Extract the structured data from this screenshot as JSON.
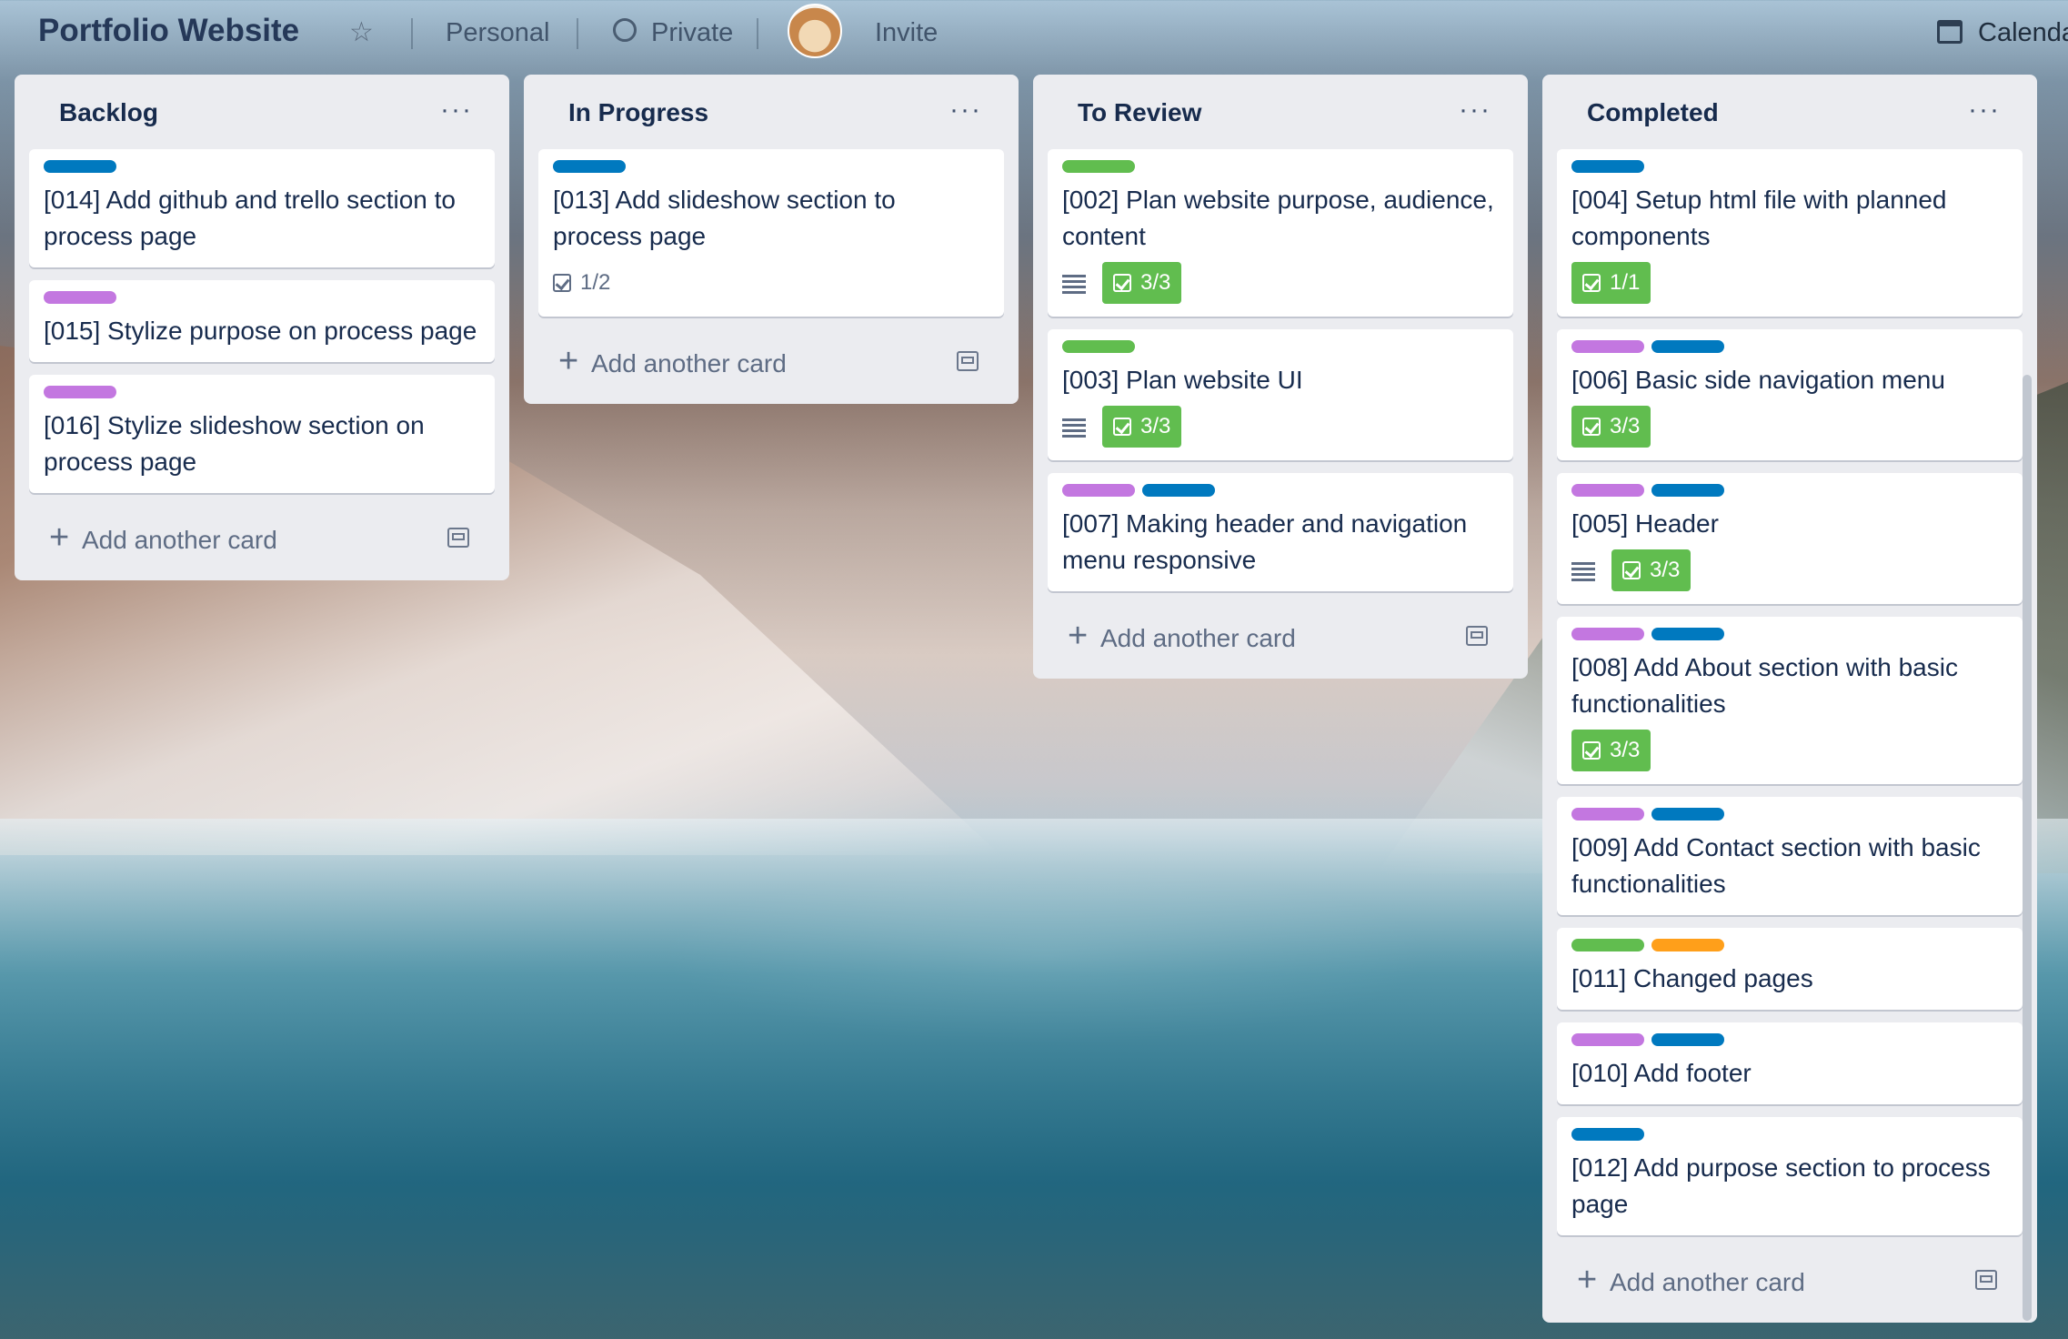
{
  "topbar": {
    "title": "Portfolio Website",
    "workspace": "Personal",
    "visibility": "Private",
    "invite": "Invite",
    "calendar": "Calenda"
  },
  "label_colors": {
    "blue": "#0079bf",
    "purple": "#c377e0",
    "green": "#61bd4f",
    "orange": "#ff9f1a"
  },
  "add_card_label": "Add another card",
  "lists": [
    {
      "title": "Backlog",
      "menu": "···",
      "cards": [
        {
          "title": "[014] Add github and trello section to process page",
          "labels": [
            "blue"
          ]
        },
        {
          "title": "[015] Stylize purpose on process page",
          "labels": [
            "purple"
          ]
        },
        {
          "title": "[016] Stylize slideshow section on process page",
          "labels": [
            "purple"
          ]
        }
      ]
    },
    {
      "title": "In Progress",
      "menu": "···",
      "cards": [
        {
          "title": "[013] Add slideshow section to process page",
          "labels": [
            "blue"
          ],
          "checklist": "1/2",
          "checklist_complete": false
        }
      ]
    },
    {
      "title": "To Review",
      "menu": "···",
      "cards": [
        {
          "title": "[002] Plan website purpose, audience, content",
          "labels": [
            "green"
          ],
          "has_description": true,
          "checklist": "3/3",
          "checklist_complete": true
        },
        {
          "title": "[003] Plan website UI",
          "labels": [
            "green"
          ],
          "has_description": true,
          "checklist": "3/3",
          "checklist_complete": true
        },
        {
          "title": "[007] Making header and navigation menu responsive",
          "labels": [
            "purple",
            "blue"
          ]
        }
      ]
    },
    {
      "title": "Completed",
      "menu": "···",
      "cards": [
        {
          "title": "[004] Setup html file with planned components",
          "labels": [
            "blue"
          ],
          "checklist": "1/1",
          "checklist_complete": true
        },
        {
          "title": "[006] Basic side navigation menu",
          "labels": [
            "purple",
            "blue"
          ],
          "checklist": "3/3",
          "checklist_complete": true
        },
        {
          "title": "[005] Header",
          "labels": [
            "purple",
            "blue"
          ],
          "has_description": true,
          "checklist": "3/3",
          "checklist_complete": true
        },
        {
          "title": "[008] Add About section with basic functionalities",
          "labels": [
            "purple",
            "blue"
          ],
          "checklist": "3/3",
          "checklist_complete": true
        },
        {
          "title": "[009] Add Contact section with basic functionalities",
          "labels": [
            "purple",
            "blue"
          ]
        },
        {
          "title": "[011] Changed pages",
          "labels": [
            "green",
            "orange"
          ]
        },
        {
          "title": "[010] Add footer",
          "labels": [
            "purple",
            "blue"
          ]
        },
        {
          "title": "[012] Add purpose section to process page",
          "labels": [
            "blue"
          ]
        }
      ]
    }
  ]
}
